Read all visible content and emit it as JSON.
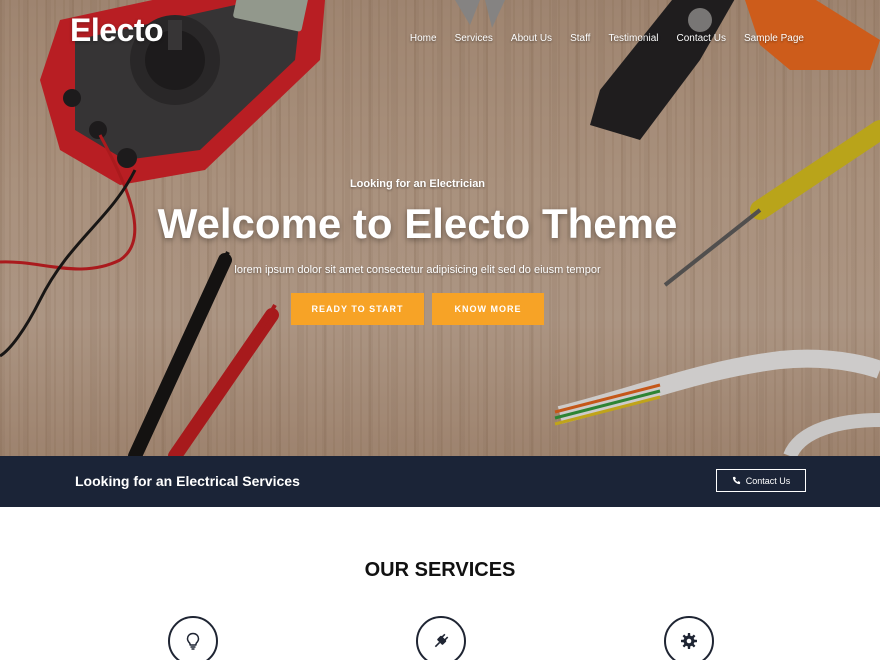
{
  "header": {
    "logo": "Electo",
    "nav": [
      "Home",
      "Services",
      "About Us",
      "Staff",
      "Testimonial",
      "Contact Us",
      "Sample Page"
    ]
  },
  "hero": {
    "subtitle": "Looking for an Electrician",
    "title": "Welcome to Electo Theme",
    "text": "lorem ipsum dolor sit amet consectetur adipisicing elit sed do eiusm tempor",
    "btn_start": "READY TO START",
    "btn_more": "KNOW MORE"
  },
  "banner": {
    "text": "Looking for an Electrical Services",
    "contact_label": "Contact Us",
    "icon": "phone-icon"
  },
  "services": {
    "title": "OUR SERVICES",
    "icons": [
      "lightbulb-icon",
      "plug-icon",
      "gear-icon"
    ]
  },
  "colors": {
    "accent": "#f7a326",
    "banner_bg": "#1b2437",
    "icon_border": "#1f2533"
  }
}
